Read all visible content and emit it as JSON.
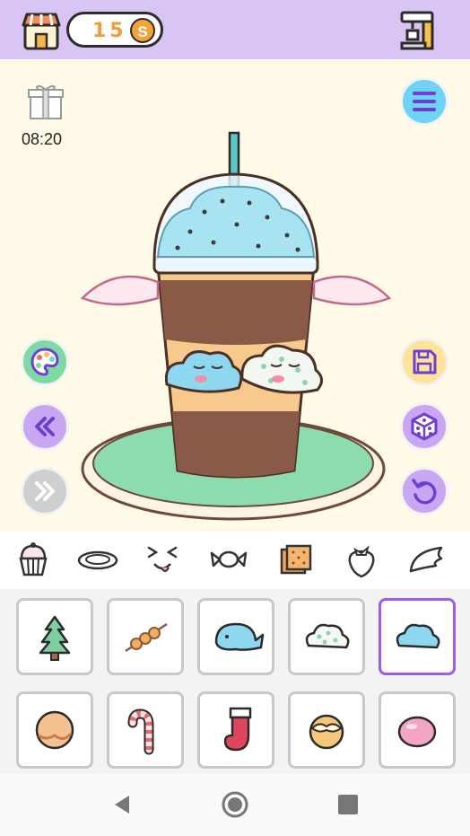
{
  "header": {
    "coins": "15",
    "coin_symbol": "S"
  },
  "timer": "08:20",
  "colors": {
    "topbar": "#d8c5f4",
    "canvas_bg": "#fffbe8",
    "selected_border": "#9c5de8",
    "accent_purple": "#c9a7f2",
    "accent_blue": "#6fd3f5",
    "accent_green": "#7fd9a6",
    "accent_yellow": "#ffe39a"
  },
  "side_buttons": {
    "left": [
      "palette-icon",
      "double-chevron-left-icon",
      "double-chevron-right-icon"
    ],
    "right": [
      "menu-icon",
      "save-icon",
      "dice-icon",
      "undo-icon"
    ]
  },
  "categories": [
    "cupcake-icon",
    "plate-icon",
    "face-icon",
    "candy-icon",
    "cracker-icon",
    "strawberry-icon",
    "wing-icon"
  ],
  "items": [
    {
      "icon": "tree-icon",
      "selected": false
    },
    {
      "icon": "skewer-icon",
      "selected": false
    },
    {
      "icon": "whale-icon",
      "selected": false
    },
    {
      "icon": "cloud-dots-icon",
      "selected": false
    },
    {
      "icon": "cloud-blue-icon",
      "selected": true
    },
    {
      "icon": "cookie-icon",
      "selected": false
    },
    {
      "icon": "candy-cane-icon",
      "selected": false
    },
    {
      "icon": "stocking-icon",
      "selected": false
    },
    {
      "icon": "cream-puff-icon",
      "selected": false
    },
    {
      "icon": "mochi-icon",
      "selected": false
    }
  ],
  "nav": [
    "back-icon",
    "home-icon",
    "recents-icon"
  ]
}
